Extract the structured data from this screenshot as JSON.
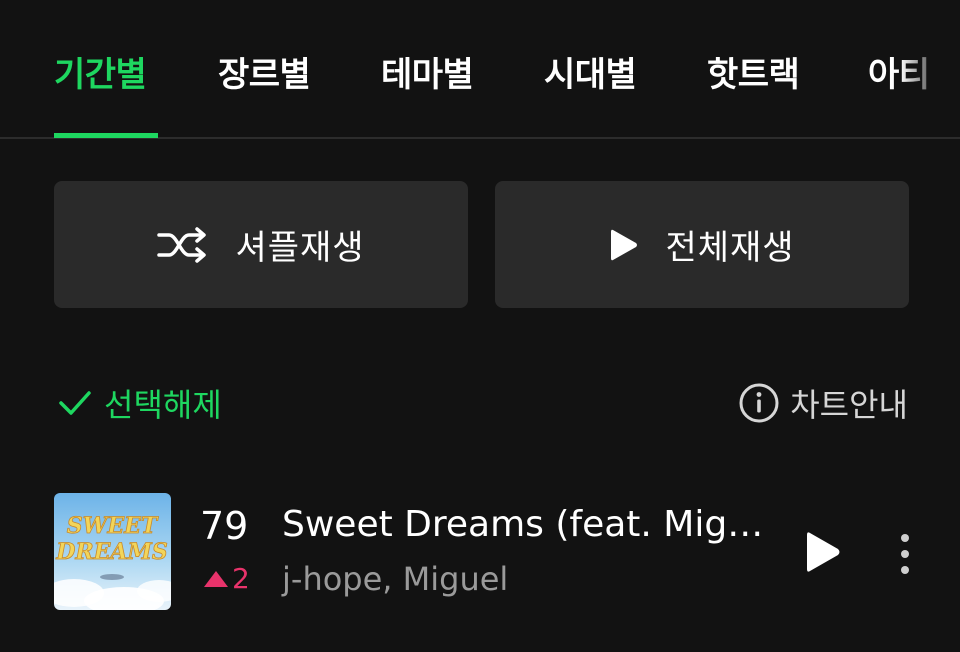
{
  "tabs": [
    {
      "label": "기간별",
      "active": true
    },
    {
      "label": "장르별",
      "active": false
    },
    {
      "label": "테마별",
      "active": false
    },
    {
      "label": "시대별",
      "active": false
    },
    {
      "label": "핫트랙",
      "active": false
    },
    {
      "label": "아티",
      "active": false
    }
  ],
  "actions": {
    "shuffle_label": "셔플재생",
    "play_all_label": "전체재생"
  },
  "selection": {
    "deselect_label": "선택해제",
    "chart_info_label": "차트안내"
  },
  "songs": [
    {
      "rank": "79",
      "rank_change": "2",
      "rank_direction": "up",
      "title": "Sweet Dreams (feat. Miguel)",
      "artist": "j-hope, Miguel",
      "cover_text_line1": "SWEET",
      "cover_text_line2": "DREAMS"
    }
  ],
  "colors": {
    "accent": "#1ed760",
    "rank_up": "#e8336b",
    "background": "#121212",
    "button_bg": "#2a2a2a"
  },
  "icons": {
    "shuffle": "shuffle-icon",
    "play": "play-icon",
    "check": "check-icon",
    "info": "info-icon",
    "more": "more-vertical-icon"
  }
}
